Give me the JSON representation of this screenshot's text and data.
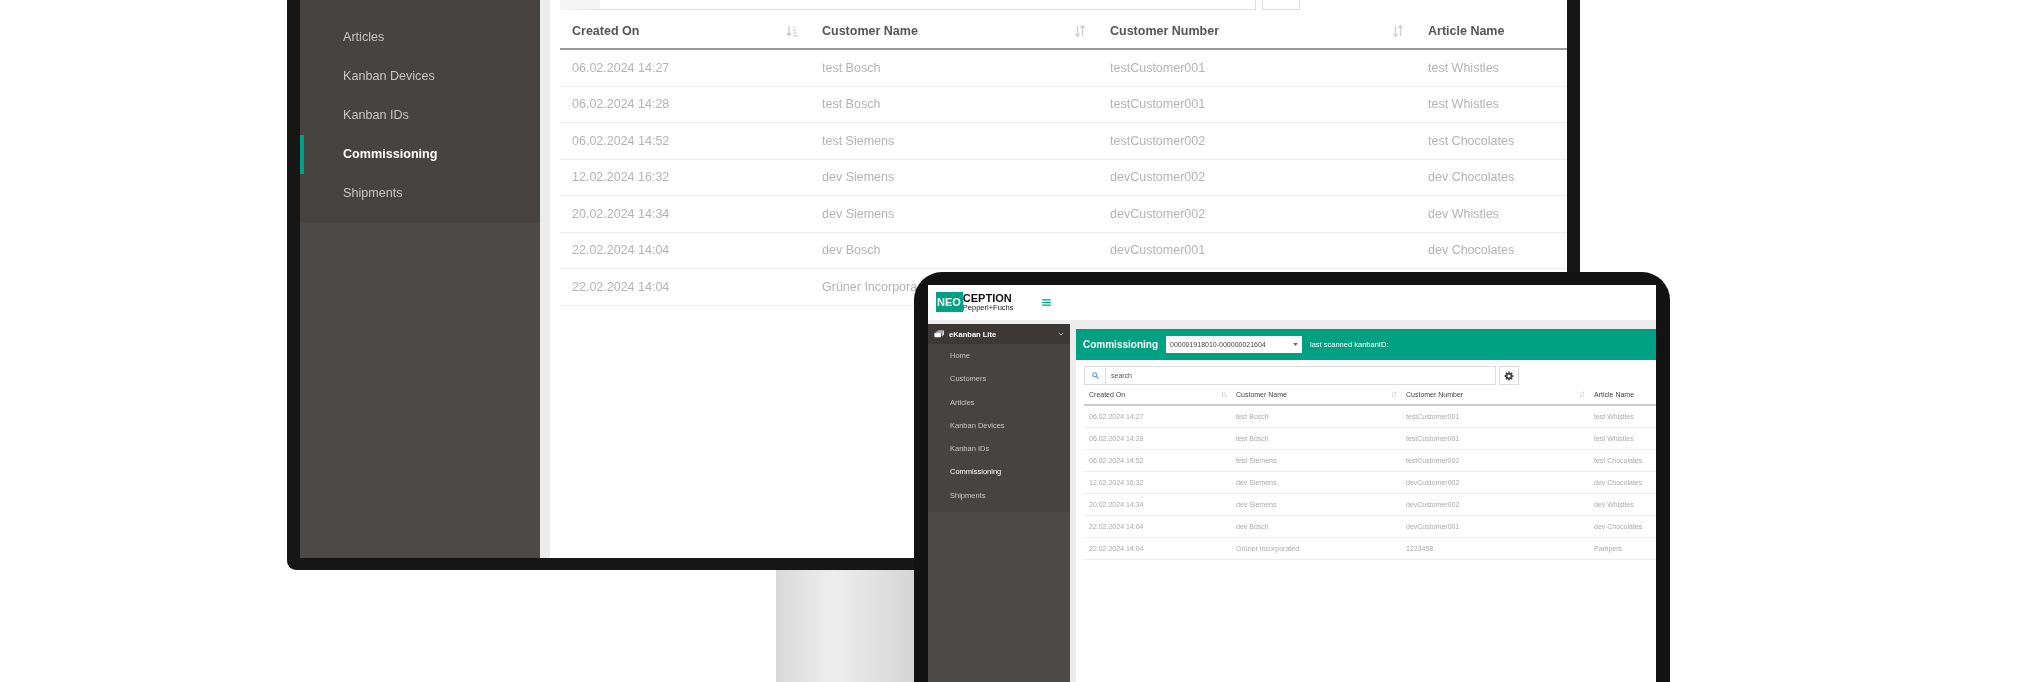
{
  "monitor": {
    "sidebar": {
      "items": [
        {
          "label": "Articles",
          "selected": false
        },
        {
          "label": "Kanban Devices",
          "selected": false
        },
        {
          "label": "Kanban IDs",
          "selected": false
        },
        {
          "label": "Commissioning",
          "selected": true
        },
        {
          "label": "Shipments",
          "selected": false
        }
      ]
    },
    "table": {
      "columns": [
        {
          "label": "Created On",
          "sorted": true
        },
        {
          "label": "Customer Name",
          "sorted": false
        },
        {
          "label": "Customer Number",
          "sorted": false
        },
        {
          "label": "Article Name"
        }
      ],
      "rows": [
        [
          "06.02.2024 14:27",
          "test Bosch",
          "testCustomer001",
          "test Whistles"
        ],
        [
          "06.02.2024 14:28",
          "test Bosch",
          "testCustomer001",
          "test Whistles"
        ],
        [
          "06.02.2024 14:52",
          "test Siemens",
          "testCustomer002",
          "test Chocolates"
        ],
        [
          "12.02.2024 16:32",
          "dev Siemens",
          "devCustomer002",
          "dev Chocolates"
        ],
        [
          "20.02.2024 14:34",
          "dev Siemens",
          "devCustomer002",
          "dev Whistles"
        ],
        [
          "22.02.2024 14:04",
          "dev Bosch",
          "devCustomer001",
          "dev Chocolates"
        ],
        [
          "22.02.2024 14:04",
          "Grüner Incorpora"
        ]
      ]
    }
  },
  "tablet": {
    "logo": {
      "mark": "NEO",
      "word": "CEPTION",
      "tagline": "Pepperl+Fuchs"
    },
    "sidebar": {
      "group": "eKanban Lite",
      "expanded": true,
      "items": [
        {
          "label": "Home",
          "selected": false
        },
        {
          "label": "Customers",
          "selected": false
        },
        {
          "label": "Articles",
          "selected": false
        },
        {
          "label": "Kanban Devices",
          "selected": false
        },
        {
          "label": "Kanban IDs",
          "selected": false
        },
        {
          "label": "Commissioning",
          "selected": true
        },
        {
          "label": "Shipments",
          "selected": false
        }
      ]
    },
    "toolbar": {
      "title": "Commissioning",
      "dropdown_value": "000001918010-000000021604",
      "last_scanned_label": "last scanned kanbanID:"
    },
    "search": {
      "placeholder": "search"
    },
    "table": {
      "columns": [
        {
          "label": "Created On",
          "sorted": true
        },
        {
          "label": "Customer Name",
          "sorted": false
        },
        {
          "label": "Customer Number",
          "sorted": false
        },
        {
          "label": "Article Name"
        }
      ],
      "rows": [
        [
          "06.02.2024 14:27",
          "test Bosch",
          "testCustomer001",
          "test Whistles"
        ],
        [
          "06.02.2024 14:28",
          "test Bosch",
          "testCustomer001",
          "test Whistles"
        ],
        [
          "06.02.2024 14:52",
          "test Siemens",
          "testCustomer002",
          "test Chocolates"
        ],
        [
          "12.02.2024 16:32",
          "dev Siemens",
          "devCustomer002",
          "dev Chocolates"
        ],
        [
          "20.02.2024 14:34",
          "dev Siemens",
          "devCustomer002",
          "dev Whistles"
        ],
        [
          "22.02.2024 14:04",
          "dev Bosch",
          "devCustomer001",
          "dev Chocolates"
        ],
        [
          "22.02.2024 14:04",
          "Grüner Incorporated",
          "1223458",
          "Pampers"
        ]
      ]
    }
  }
}
